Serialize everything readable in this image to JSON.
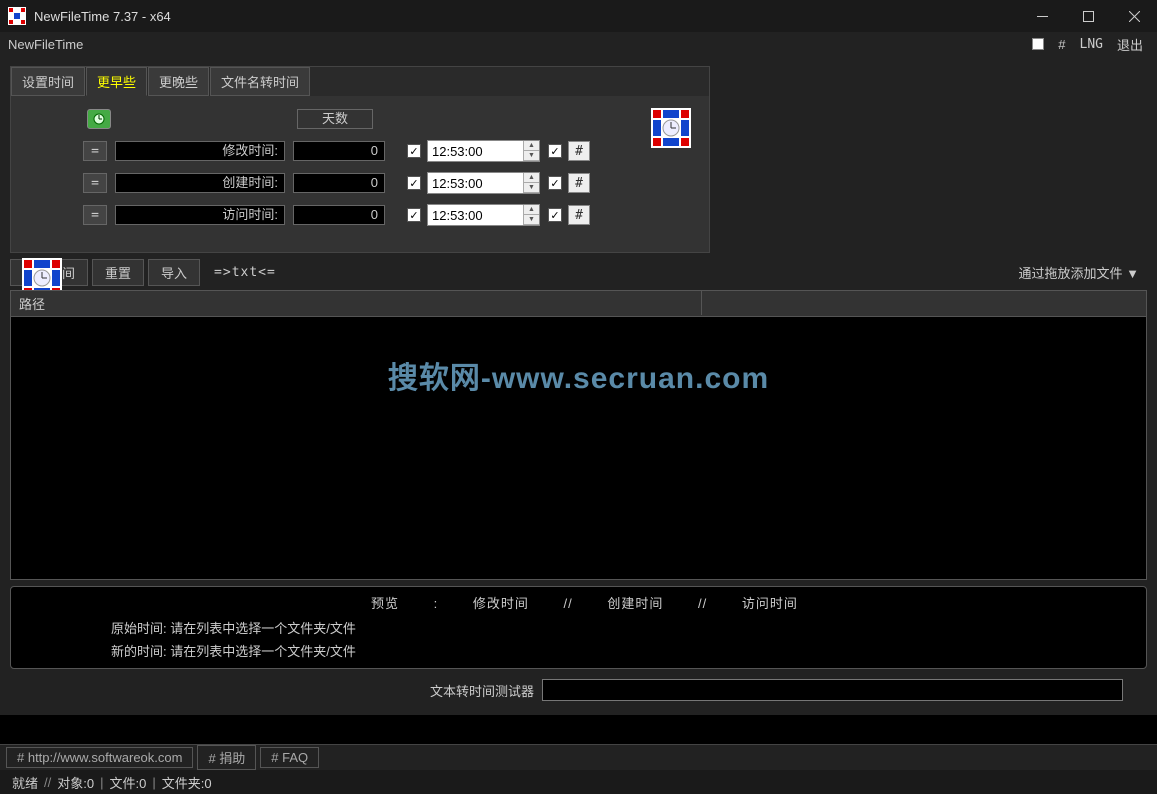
{
  "window": {
    "title": "NewFileTime 7.37 - x64"
  },
  "menubar": {
    "app_name": "NewFileTime",
    "hash": "#",
    "lng": "LNG",
    "exit": "退出"
  },
  "tabs": [
    {
      "label": "设置时间",
      "active": false
    },
    {
      "label": "更早些",
      "active": true
    },
    {
      "label": "更晚些",
      "active": false
    },
    {
      "label": "文件名转时间",
      "active": false
    }
  ],
  "panel": {
    "days_header": "天数",
    "rows": [
      {
        "label": "修改时间:",
        "value": "0",
        "time": "12:53:00",
        "cb1": true,
        "cb2": true
      },
      {
        "label": "创建时间:",
        "value": "0",
        "time": "12:53:00",
        "cb1": true,
        "cb2": true
      },
      {
        "label": "访问时间:",
        "value": "0",
        "time": "12:53:00",
        "cb1": true,
        "cb2": true
      }
    ],
    "eq": "=",
    "hash": "#"
  },
  "toolbar": {
    "update": "更新时间",
    "reset": "重置",
    "import": "导入",
    "txt": "=>txt<=",
    "drag_hint": "通过拖放添加文件 ▼"
  },
  "list": {
    "path_header": "路径",
    "watermark": "搜软网-www.secruan.com"
  },
  "preview": {
    "title": "预览",
    "colon": ":",
    "sep": "//",
    "col_modify": "修改时间",
    "col_create": "创建时间",
    "col_access": "访问时间",
    "orig_label": "原始时间:",
    "orig_value": "请在列表中选择一个文件夹/文件",
    "new_label": "新的时间:",
    "new_value": "请在列表中选择一个文件夹/文件"
  },
  "tester": {
    "label": "文本转时间测试器"
  },
  "footer": {
    "link1": "# http://www.softwareok.com",
    "link2": "# 捐助",
    "link3": "# FAQ"
  },
  "status": {
    "ready": "就绪",
    "objects": "对象:0",
    "files": "文件:0",
    "folders": "文件夹:0",
    "sep": "//",
    "bar": "|"
  }
}
